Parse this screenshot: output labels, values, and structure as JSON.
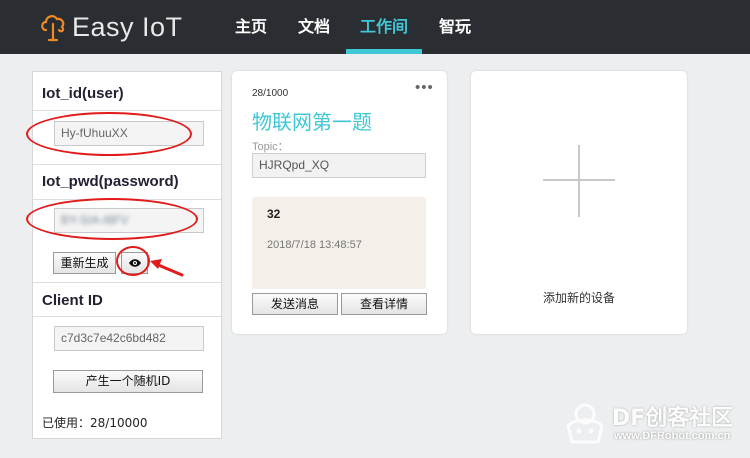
{
  "navbar": {
    "logo_text": "Easy IoT",
    "items": [
      "主页",
      "文档",
      "工作间",
      "智玩"
    ],
    "active_index": 2,
    "colors": {
      "background": "#2a2d31",
      "accent": "#3fc7d6"
    }
  },
  "credentials": {
    "iot_id_label": "Iot_id(user)",
    "iot_id_value": "Hy-fUhuuXX",
    "iot_pwd_label": "Iot_pwd(password)",
    "iot_pwd_value": "BY-SIA-I8FV",
    "regenerate_label": "重新生成",
    "toggle_visibility_icon": "eye-icon",
    "client_id_label": "Client ID",
    "client_id_value": "c7d3c7e42c6bd482",
    "random_id_label": "产生一个随机ID",
    "usage_text": "已使用：28/10000"
  },
  "device": {
    "count": "28/1000",
    "menu": "•••",
    "title": "物联网第一题",
    "topic_label": "Topic：",
    "topic_value": "HJRQpd_XQ",
    "last_message": "32",
    "last_time": "2018/7/18 13:48:57",
    "send_label": "发送消息",
    "details_label": "查看详情"
  },
  "add_device": {
    "label": "添加新的设备",
    "icon": "plus-icon"
  },
  "watermark": {
    "text": "DF创客社区",
    "url": "www.DFRobot.com.cn"
  }
}
